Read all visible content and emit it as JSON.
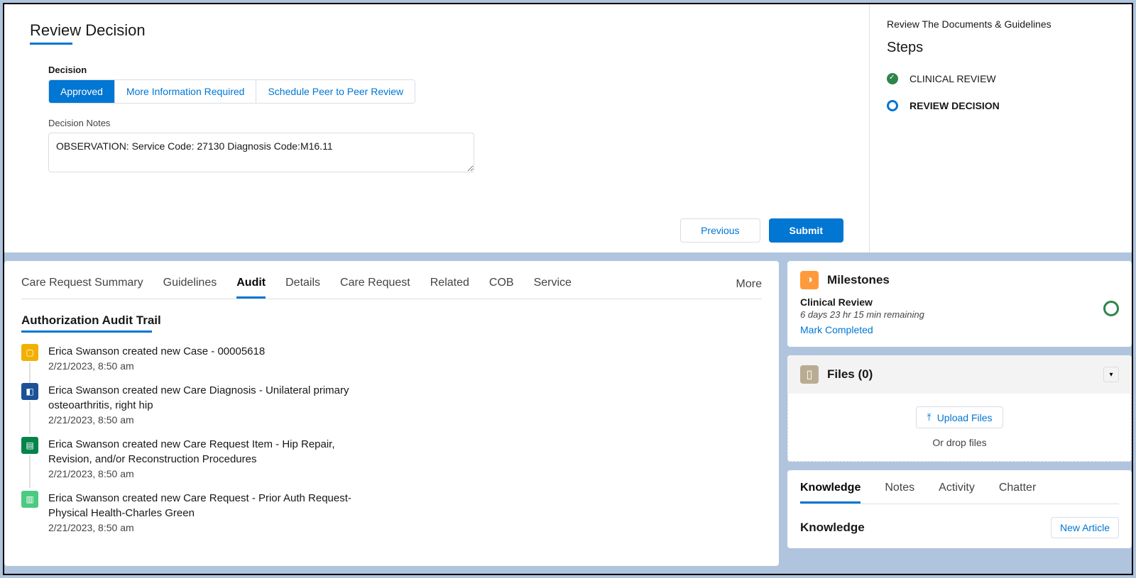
{
  "header": {
    "title": "Review Decision"
  },
  "decision": {
    "label": "Decision",
    "options": [
      "Approved",
      "More Information Required",
      "Schedule Peer to Peer Review"
    ],
    "selected": 0,
    "notes_label": "Decision Notes",
    "notes_value": "OBSERVATION: Service Code: 27130 Diagnosis Code:M16.11"
  },
  "actions": {
    "previous": "Previous",
    "submit": "Submit"
  },
  "sidebar": {
    "title": "Review The Documents & Guidelines",
    "steps_heading": "Steps",
    "steps": [
      {
        "label": "CLINICAL REVIEW",
        "state": "done"
      },
      {
        "label": "REVIEW DECISION",
        "state": "current"
      }
    ]
  },
  "tabs": {
    "items": [
      "Care Request Summary",
      "Guidelines",
      "Audit",
      "Details",
      "Care Request",
      "Related",
      "COB",
      "Service"
    ],
    "active": 2,
    "more": "More"
  },
  "audit": {
    "heading": "Authorization Audit Trail",
    "items": [
      {
        "desc": "Erica Swanson created new Case - 00005618",
        "time": "2/21/2023, 8:50 am",
        "icon": "case"
      },
      {
        "desc": "Erica Swanson created new Care Diagnosis - Unilateral primary osteoarthritis, right hip",
        "time": "2/21/2023, 8:50 am",
        "icon": "diagnosis"
      },
      {
        "desc": "Erica Swanson created new Care Request Item - Hip Repair, Revision, and/or Reconstruction Procedures",
        "time": "2/21/2023, 8:50 am",
        "icon": "request-item"
      },
      {
        "desc": "Erica Swanson created new Care Request - Prior Auth Request-Physical Health-Charles Green",
        "time": "2/21/2023, 8:50 am",
        "icon": "request"
      }
    ]
  },
  "milestones": {
    "heading": "Milestones",
    "name": "Clinical Review",
    "remaining": "6 days 23 hr 15 min remaining",
    "mark_completed": "Mark Completed"
  },
  "files": {
    "heading": "Files (0)",
    "upload": "Upload Files",
    "drop": "Or drop files"
  },
  "knowledge": {
    "tabs": [
      "Knowledge",
      "Notes",
      "Activity",
      "Chatter"
    ],
    "active": 0,
    "heading": "Knowledge",
    "new_article": "New Article"
  }
}
